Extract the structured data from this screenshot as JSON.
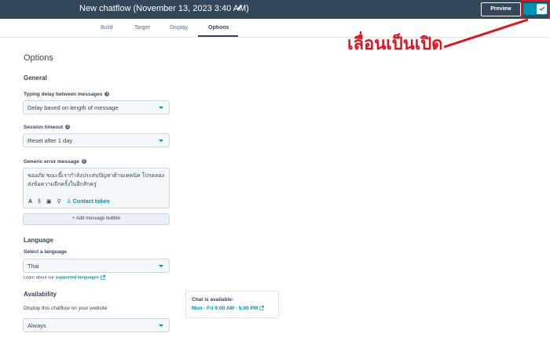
{
  "header": {
    "title": "New chatflow (November 13, 2023 3:40 AM)",
    "preview_label": "Preview",
    "toggle_icon": "check-icon"
  },
  "tabs": [
    {
      "label": "Build"
    },
    {
      "label": "Target"
    },
    {
      "label": "Display"
    },
    {
      "label": "Options",
      "active": true
    }
  ],
  "annotation": {
    "text": "เลื่อนเป็นเปิด",
    "color": "#e0141e"
  },
  "options": {
    "title": "Options",
    "general": {
      "heading": "General",
      "typing_delay": {
        "label": "Typing delay between messages",
        "value": "Delay based on length of message"
      },
      "session_timeout": {
        "label": "Session timeout",
        "value": "Reset after 1 day"
      },
      "error_message": {
        "label": "Generic error message",
        "text": "ขออภัย ขณะนี้เรากำลังประสบปัญหาด้านเทคนิค โปรดลองส่งข้อความอีกครั้งในอีกสักครู่",
        "toolbar": [
          "A",
          "§",
          "▣",
          "⚲"
        ],
        "contact_token": "Contact token",
        "add_bubble": "+ Add message bubble"
      }
    },
    "language": {
      "heading": "Language",
      "label": "Select a language",
      "value": "Thai",
      "learn_prefix": "Learn about our",
      "learn_link": "supported languages"
    },
    "availability": {
      "heading": "Availability",
      "description": "Display this chatflow on your website:",
      "value": "Always",
      "card_title": "Chat is available:",
      "card_hours": "Mon - Fri 9:00 AM - 5:00 PM"
    }
  },
  "colors": {
    "header_bg": "#33475b",
    "accent": "#0091ae",
    "annotation": "#e0141e"
  }
}
